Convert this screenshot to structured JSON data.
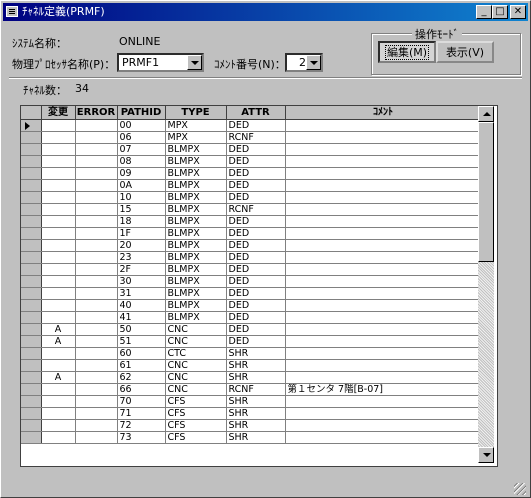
{
  "window": {
    "title": "ﾁｬﾈﾙ定義(PRMF)",
    "controls": {
      "minimize": "_",
      "maximize": "□",
      "close": "✕"
    }
  },
  "system": {
    "label": "ｼｽﾃﾑ名称：",
    "value": "ONLINE"
  },
  "processor": {
    "label": "物理ﾌﾟﾛｾｯｻ名称(P)：",
    "value": "PRMF1"
  },
  "comment_no": {
    "label": "ｺﾒﾝﾄ番号(N)：",
    "value": "2"
  },
  "mode_group": {
    "title": "操作ﾓｰﾄﾞ",
    "edit_label": "編集(M)",
    "view_label": "表示(V)",
    "active": "edit"
  },
  "channel_count": {
    "label": "ﾁｬﾈﾙ数：",
    "value": "34"
  },
  "table": {
    "columns": [
      "",
      "変更",
      "ERROR",
      "PATHID",
      "TYPE",
      "ATTR",
      "ｺﾒﾝﾄ"
    ],
    "rows": [
      {
        "mark": "current",
        "change": "",
        "error": "",
        "pathid": "00",
        "type": "MPX",
        "attr": "DED",
        "comment": ""
      },
      {
        "mark": "",
        "change": "",
        "error": "",
        "pathid": "06",
        "type": "MPX",
        "attr": "RCNF",
        "comment": ""
      },
      {
        "mark": "",
        "change": "",
        "error": "",
        "pathid": "07",
        "type": "BLMPX",
        "attr": "DED",
        "comment": ""
      },
      {
        "mark": "",
        "change": "",
        "error": "",
        "pathid": "08",
        "type": "BLMPX",
        "attr": "DED",
        "comment": ""
      },
      {
        "mark": "",
        "change": "",
        "error": "",
        "pathid": "09",
        "type": "BLMPX",
        "attr": "DED",
        "comment": ""
      },
      {
        "mark": "",
        "change": "",
        "error": "",
        "pathid": "0A",
        "type": "BLMPX",
        "attr": "DED",
        "comment": ""
      },
      {
        "mark": "",
        "change": "",
        "error": "",
        "pathid": "10",
        "type": "BLMPX",
        "attr": "DED",
        "comment": ""
      },
      {
        "mark": "",
        "change": "",
        "error": "",
        "pathid": "15",
        "type": "BLMPX",
        "attr": "RCNF",
        "comment": ""
      },
      {
        "mark": "",
        "change": "",
        "error": "",
        "pathid": "18",
        "type": "BLMPX",
        "attr": "DED",
        "comment": ""
      },
      {
        "mark": "",
        "change": "",
        "error": "",
        "pathid": "1F",
        "type": "BLMPX",
        "attr": "DED",
        "comment": ""
      },
      {
        "mark": "",
        "change": "",
        "error": "",
        "pathid": "20",
        "type": "BLMPX",
        "attr": "DED",
        "comment": ""
      },
      {
        "mark": "",
        "change": "",
        "error": "",
        "pathid": "23",
        "type": "BLMPX",
        "attr": "DED",
        "comment": ""
      },
      {
        "mark": "",
        "change": "",
        "error": "",
        "pathid": "2F",
        "type": "BLMPX",
        "attr": "DED",
        "comment": ""
      },
      {
        "mark": "",
        "change": "",
        "error": "",
        "pathid": "30",
        "type": "BLMPX",
        "attr": "DED",
        "comment": ""
      },
      {
        "mark": "",
        "change": "",
        "error": "",
        "pathid": "31",
        "type": "BLMPX",
        "attr": "DED",
        "comment": ""
      },
      {
        "mark": "",
        "change": "",
        "error": "",
        "pathid": "40",
        "type": "BLMPX",
        "attr": "DED",
        "comment": ""
      },
      {
        "mark": "",
        "change": "",
        "error": "",
        "pathid": "41",
        "type": "BLMPX",
        "attr": "DED",
        "comment": ""
      },
      {
        "mark": "",
        "change": "A",
        "error": "",
        "pathid": "50",
        "type": "CNC",
        "attr": "DED",
        "comment": ""
      },
      {
        "mark": "",
        "change": "A",
        "error": "",
        "pathid": "51",
        "type": "CNC",
        "attr": "DED",
        "comment": ""
      },
      {
        "mark": "",
        "change": "",
        "error": "",
        "pathid": "60",
        "type": "CTC",
        "attr": "SHR",
        "comment": ""
      },
      {
        "mark": "",
        "change": "",
        "error": "",
        "pathid": "61",
        "type": "CNC",
        "attr": "SHR",
        "comment": ""
      },
      {
        "mark": "",
        "change": "A",
        "error": "",
        "pathid": "62",
        "type": "CNC",
        "attr": "SHR",
        "comment": ""
      },
      {
        "mark": "",
        "change": "",
        "error": "",
        "pathid": "66",
        "type": "CNC",
        "attr": "RCNF",
        "comment": "第１センタ 7階[B-07]"
      },
      {
        "mark": "",
        "change": "",
        "error": "",
        "pathid": "70",
        "type": "CFS",
        "attr": "SHR",
        "comment": ""
      },
      {
        "mark": "",
        "change": "",
        "error": "",
        "pathid": "71",
        "type": "CFS",
        "attr": "SHR",
        "comment": ""
      },
      {
        "mark": "",
        "change": "",
        "error": "",
        "pathid": "72",
        "type": "CFS",
        "attr": "SHR",
        "comment": ""
      },
      {
        "mark": "",
        "change": "",
        "error": "",
        "pathid": "73",
        "type": "CFS",
        "attr": "SHR",
        "comment": ""
      }
    ]
  }
}
